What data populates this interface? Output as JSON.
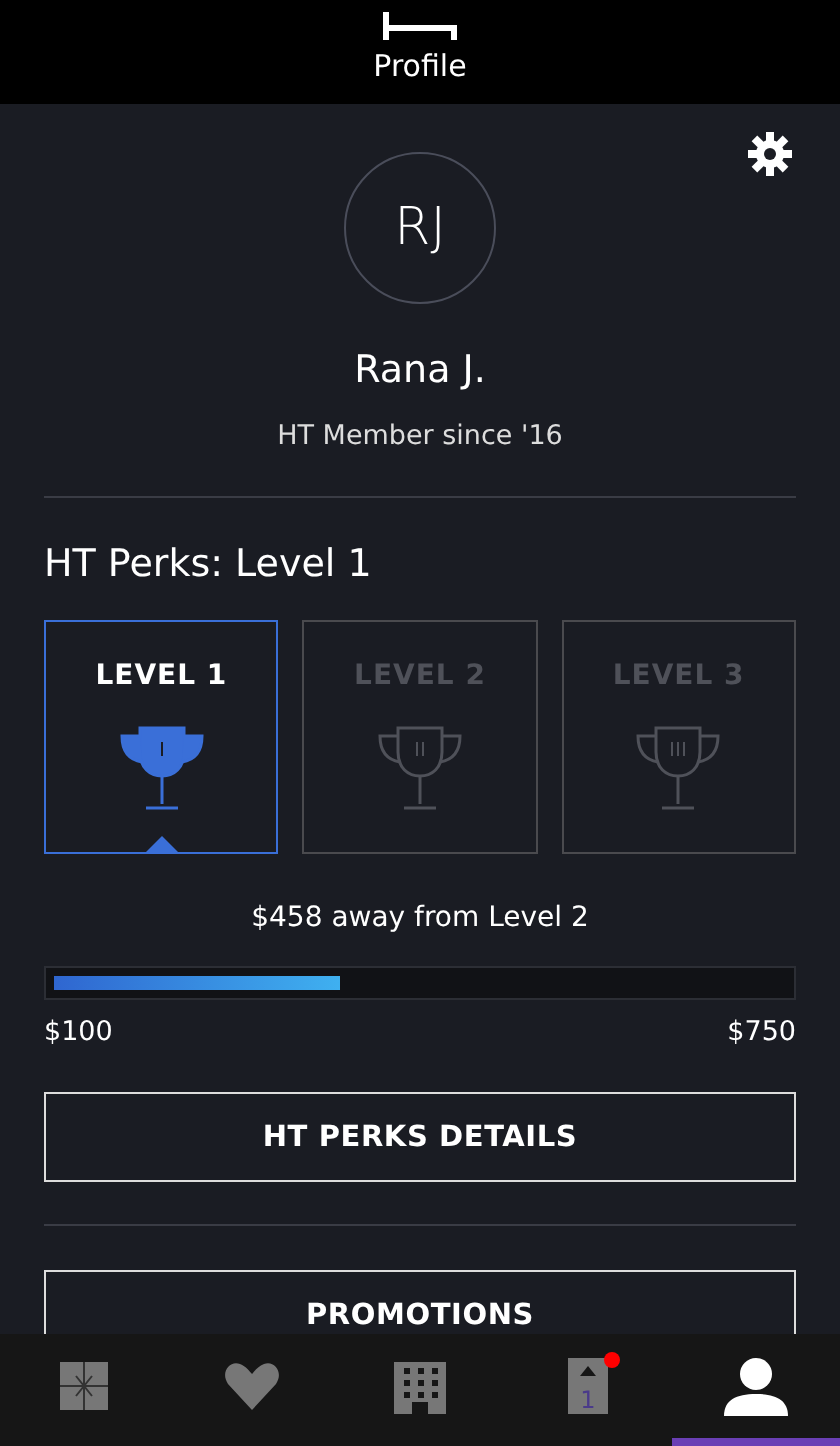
{
  "header": {
    "title": "Profile"
  },
  "profile": {
    "initials": "RJ",
    "name": "Rana J.",
    "member_since": "HT Member since '16"
  },
  "perks": {
    "title": "HT Perks: Level 1",
    "levels": [
      {
        "label": "LEVEL 1",
        "selected": true
      },
      {
        "label": "LEVEL 2",
        "selected": false
      },
      {
        "label": "LEVEL 3",
        "selected": false
      }
    ],
    "progress_text": "$458 away from Level 2",
    "level": 0.39,
    "min_label": "$100",
    "max_label": "$750"
  },
  "buttons": [
    {
      "label": "HT PERKS DETAILS"
    },
    {
      "label": "PROMOTIONS"
    }
  ],
  "tab_bar": [
    {
      "kind": "gift",
      "selected": false,
      "badge": false
    },
    {
      "kind": "heart",
      "selected": false,
      "badge": false
    },
    {
      "kind": "hotel",
      "selected": false,
      "badge": false
    },
    {
      "kind": "upgrade",
      "selected": false,
      "badge": true,
      "icon_text": "1"
    },
    {
      "kind": "person",
      "selected": true,
      "badge": false
    }
  ]
}
